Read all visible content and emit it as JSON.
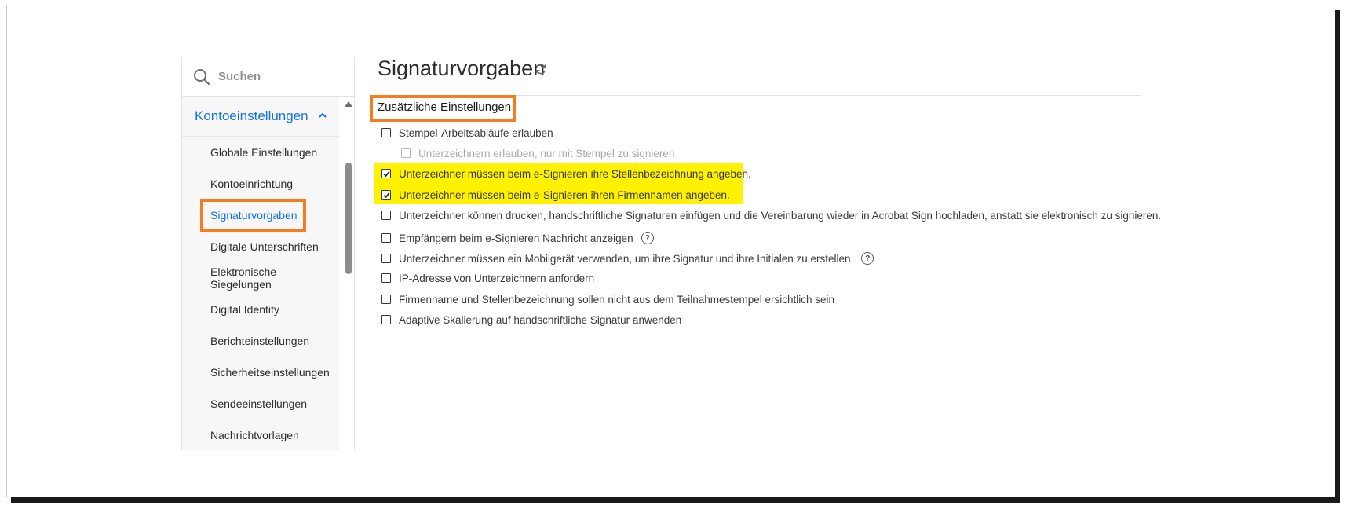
{
  "search": {
    "placeholder": "Suchen"
  },
  "sidebar": {
    "group_label": "Kontoeinstellungen",
    "items": [
      {
        "label": "Globale Einstellungen"
      },
      {
        "label": "Kontoeinrichtung"
      },
      {
        "label": "Signaturvorgaben",
        "active": true
      },
      {
        "label": "Digitale Unterschriften"
      },
      {
        "label": "Elektronische Siegelungen"
      },
      {
        "label": "Digital Identity"
      },
      {
        "label": "Berichteinstellungen"
      },
      {
        "label": "Sicherheitseinstellungen"
      },
      {
        "label": "Sendeeinstellungen"
      },
      {
        "label": "Nachrichtvorlagen"
      }
    ]
  },
  "main": {
    "title": "Signaturvorgaben",
    "section_title": "Zusätzliche Einstellungen",
    "options": [
      {
        "label": "Stempel-Arbeitsabläufe erlauben",
        "checked": false
      },
      {
        "label": "Unterzeichnern erlauben, nur mit Stempel zu signieren",
        "checked": false,
        "disabled": true
      },
      {
        "label": "Unterzeichner müssen beim e-Signieren ihre Stellenbezeichnung angeben.",
        "checked": true
      },
      {
        "label": "Unterzeichner müssen beim e-Signieren ihren Firmennamen angeben.",
        "checked": true
      },
      {
        "label": "Unterzeichner können drucken, handschriftliche Signaturen einfügen und die Vereinbarung wieder in Acrobat Sign hochladen, anstatt sie elektronisch zu signieren.",
        "checked": false
      },
      {
        "label": "Empfängern beim e-Signieren Nachricht anzeigen",
        "checked": false,
        "help": "?"
      },
      {
        "label": "Unterzeichner müssen ein Mobilgerät verwenden, um ihre Signatur und ihre Initialen zu erstellen.",
        "checked": false,
        "help": "?"
      },
      {
        "label": "IP-Adresse von Unterzeichnern anfordern",
        "checked": false
      },
      {
        "label": "Firmenname und Stellenbezeichnung sollen nicht aus dem Teilnahmestempel ersichtlich sein",
        "checked": false
      },
      {
        "label": "Adaptive Skalierung auf handschriftliche Signatur anwenden",
        "checked": false
      }
    ]
  },
  "colors": {
    "accent": "#1473e6",
    "highlight_box": "#f47d20",
    "highlight_fill": "#fff200"
  }
}
